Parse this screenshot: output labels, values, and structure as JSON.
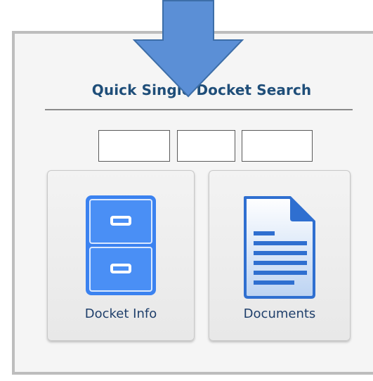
{
  "search": {
    "title": "Quick Single Docket Search",
    "fields": [
      {
        "value": "",
        "placeholder": ""
      },
      {
        "value": "",
        "placeholder": ""
      },
      {
        "value": "",
        "placeholder": ""
      }
    ]
  },
  "tiles": [
    {
      "label": "Docket Info",
      "icon": "filing-cabinet-icon"
    },
    {
      "label": "Documents",
      "icon": "document-icon"
    }
  ],
  "colors": {
    "title": "#1f4e79",
    "arrow_fill": "#5b8fd6",
    "arrow_stroke": "#3d6ea8",
    "icon_blue": "#3b82f0"
  }
}
